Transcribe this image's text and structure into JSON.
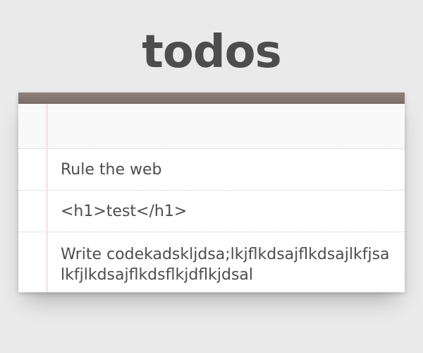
{
  "header": {
    "title": "todos"
  },
  "new_todo": {
    "value": "",
    "placeholder": ""
  },
  "todos": [
    {
      "label": "Rule the web"
    },
    {
      "label": "<h1>test</h1>"
    },
    {
      "label": "Write codekadskljdsa;lkjflkdsajflkdsajlkfjsalkfjlkdsajflkdsflkjdflkjdsal"
    }
  ],
  "colors": {
    "background": "#eaeaea",
    "title": "#4d4d4d",
    "top_bar": "#8a7c75",
    "card": "#ffffff",
    "margin_line": "#f5d6d6"
  }
}
